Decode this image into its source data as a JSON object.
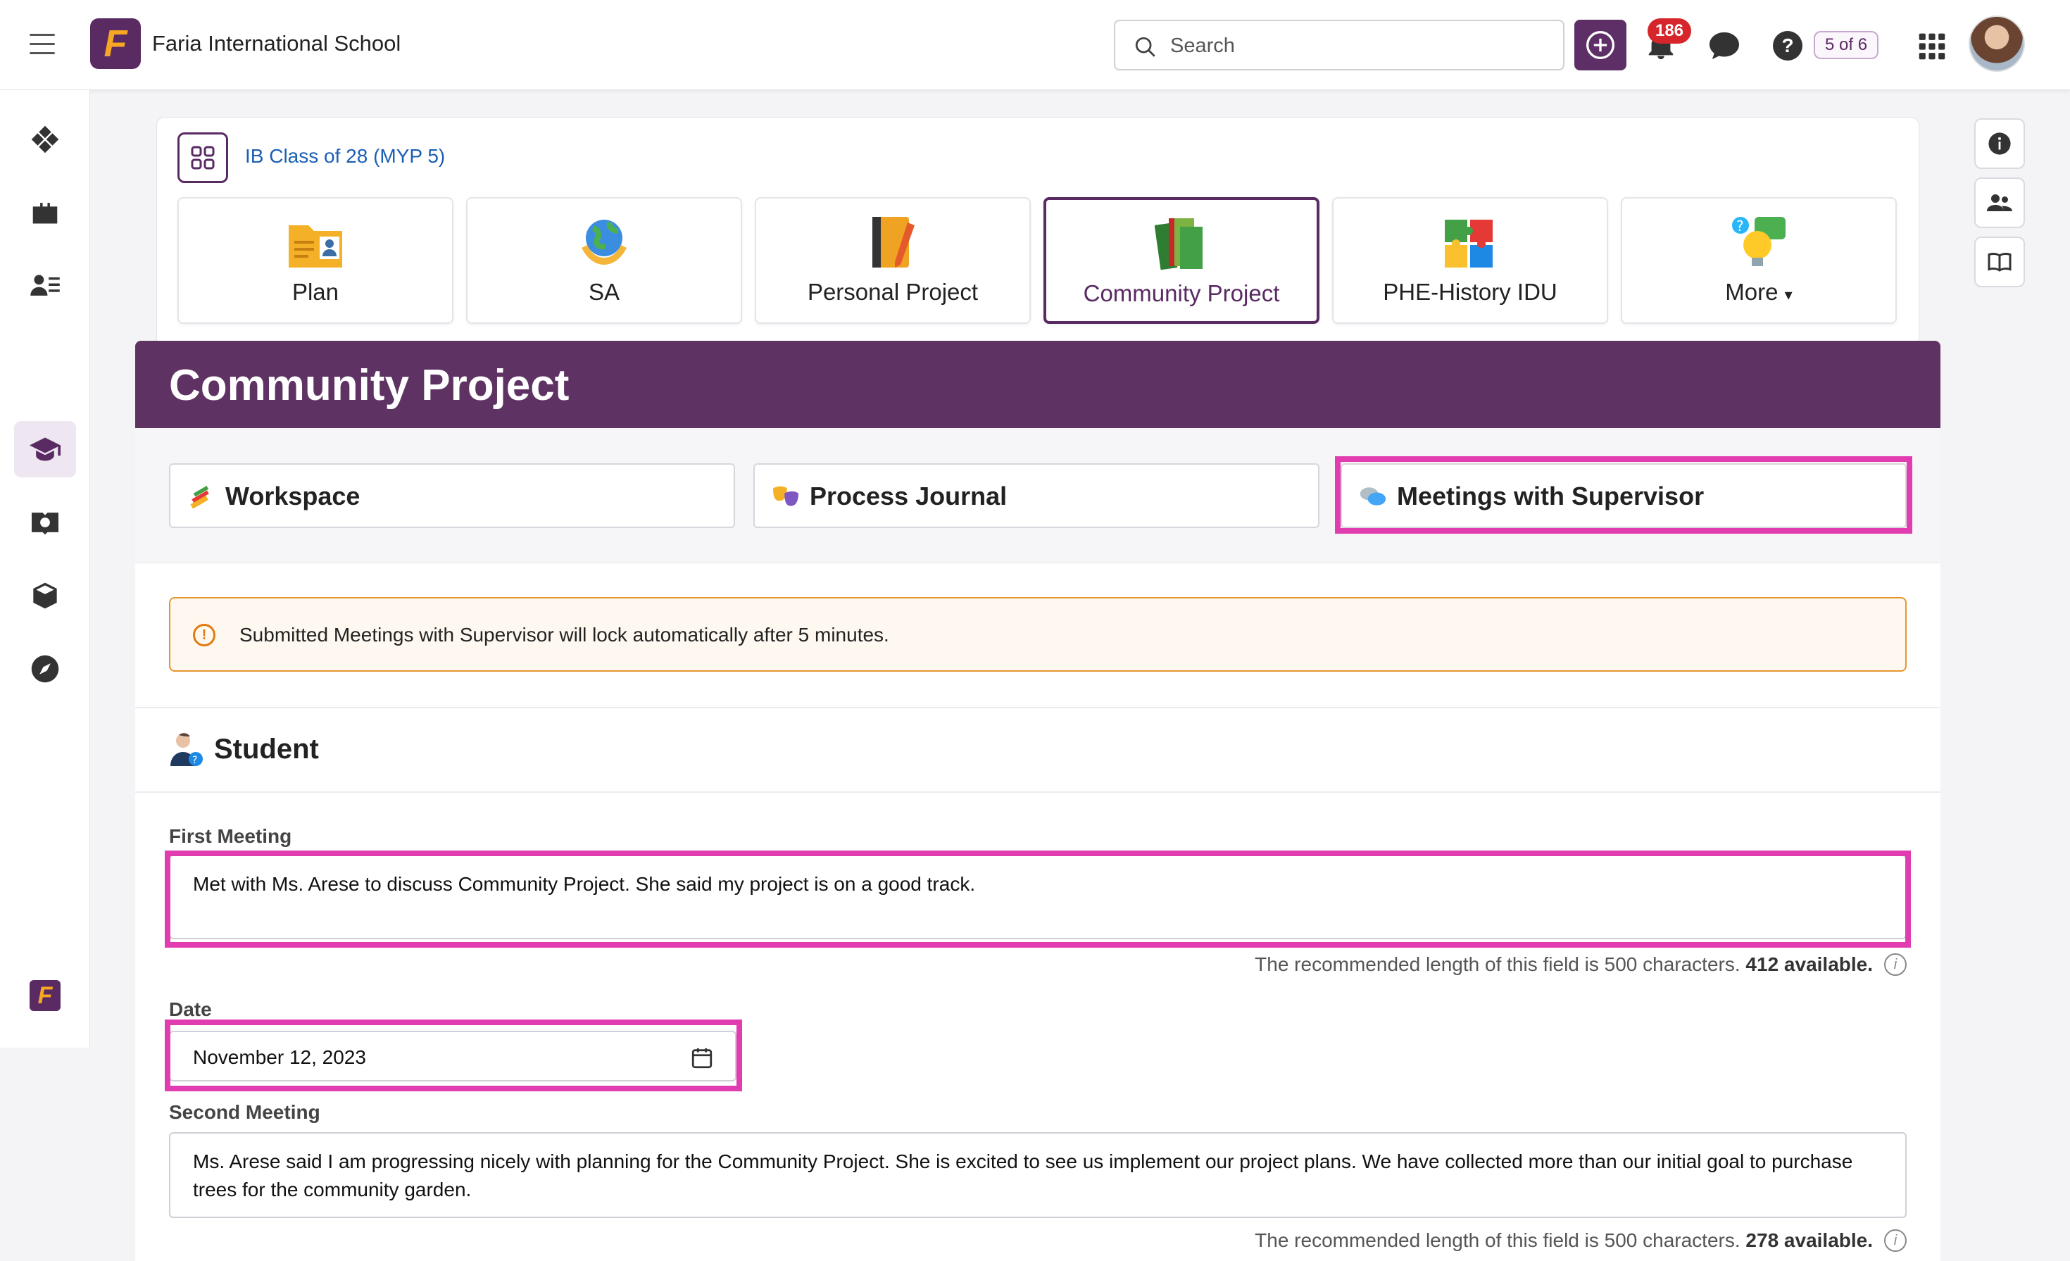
{
  "header": {
    "school_name": "Faria International School",
    "logo_letter": "F",
    "search_placeholder": "Search",
    "notifications_count": "186",
    "pager": "5 of 6",
    "help_glyph": "?"
  },
  "class": {
    "link": "IB Class of 28 (MYP 5)",
    "tiles": [
      {
        "label": "Plan",
        "icon": "folder-id-icon"
      },
      {
        "label": "SA",
        "icon": "globe-hands-icon"
      },
      {
        "label": "Personal Project",
        "icon": "notebook-pencil-icon"
      },
      {
        "label": "Community Project",
        "icon": "books-icon",
        "active": true
      },
      {
        "label": "PHE-History IDU",
        "icon": "puzzle-icon"
      },
      {
        "label": "More",
        "icon": "lightbulb-chat-icon"
      }
    ]
  },
  "banner": {
    "title": "Community Project"
  },
  "subtabs": [
    {
      "label": "Workspace",
      "icon": "pencils-icon"
    },
    {
      "label": "Process Journal",
      "icon": "masks-icon"
    },
    {
      "label": "Meetings with Supervisor",
      "icon": "speech-bubbles-icon",
      "selected": true
    }
  ],
  "alert": {
    "icon_glyph": "!",
    "text": "Submitted Meetings with Supervisor will lock automatically after 5 minutes."
  },
  "student": {
    "section_title": "Student",
    "first_meeting": {
      "label": "First Meeting",
      "value": "Met with Ms. Arese to discuss Community Project. She said my project is on a good track.",
      "hint_prefix": "The recommended length of this field is 500 characters.",
      "hint_available": "412 available."
    },
    "date": {
      "label": "Date",
      "value": "November 12, 2023"
    },
    "second_meeting": {
      "label": "Second Meeting",
      "value": "Ms. Arese said I am progressing nicely with planning for the Community Project. She is excited to see us implement our project plans. We have collected more than our initial goal to purchase trees for the community garden.",
      "hint_prefix": "The recommended length of this field is 500 characters.",
      "hint_available": "278 available."
    },
    "info_glyph": "i"
  },
  "colors": {
    "brand": "#5e3262",
    "highlight": "#e23db0",
    "alert_border": "#e9952e",
    "link": "#1a5fb4",
    "badge": "#d7262b"
  }
}
